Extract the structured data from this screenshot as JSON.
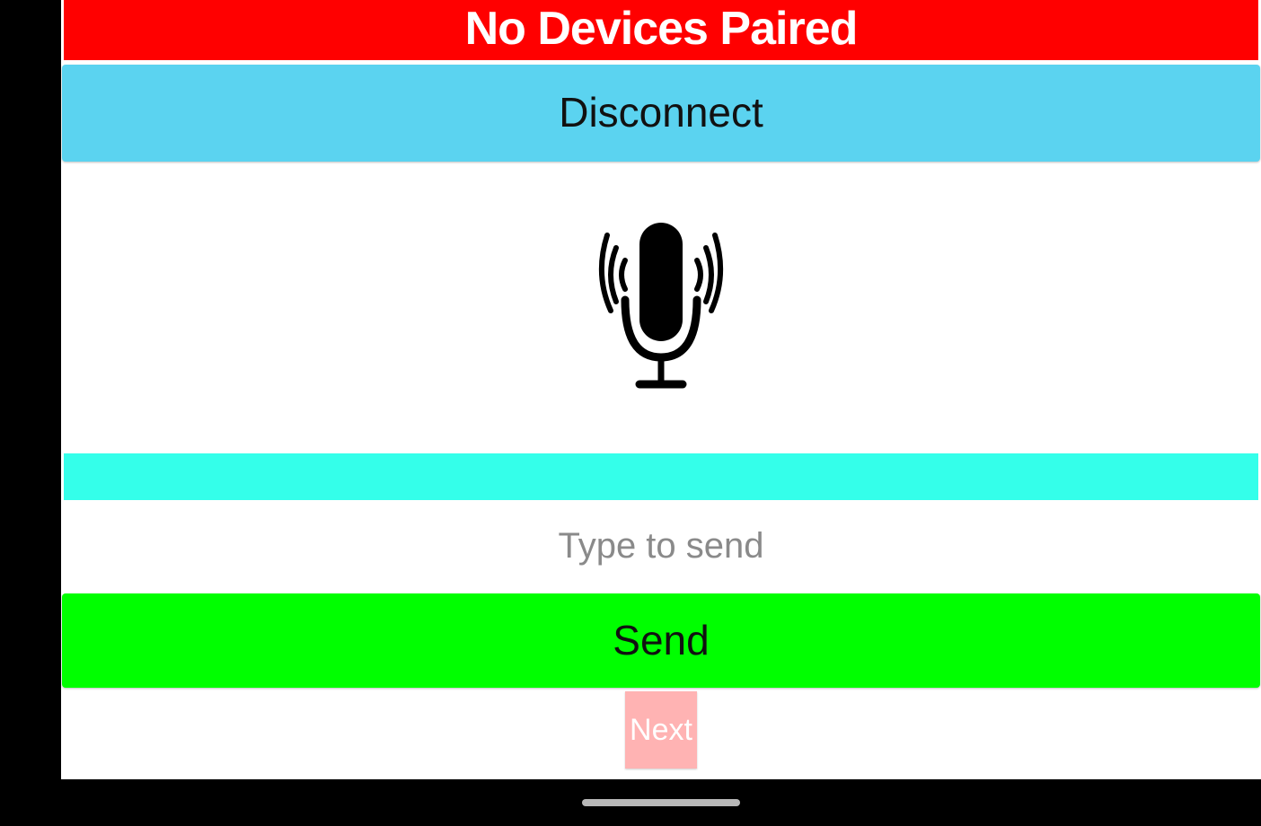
{
  "header": {
    "status_text": "No Devices Paired",
    "background_color": "#ff0000"
  },
  "controls": {
    "disconnect_label": "Disconnect",
    "disconnect_color": "#5bd3f0",
    "mic_icon": "microphone-broadcast-icon",
    "received_text": "",
    "received_color": "#34ffea",
    "input_placeholder": "Type to send",
    "input_value": "",
    "send_label": "Send",
    "send_color": "#00ff00",
    "next_label": "Next",
    "next_color": "#ffb3b3"
  }
}
